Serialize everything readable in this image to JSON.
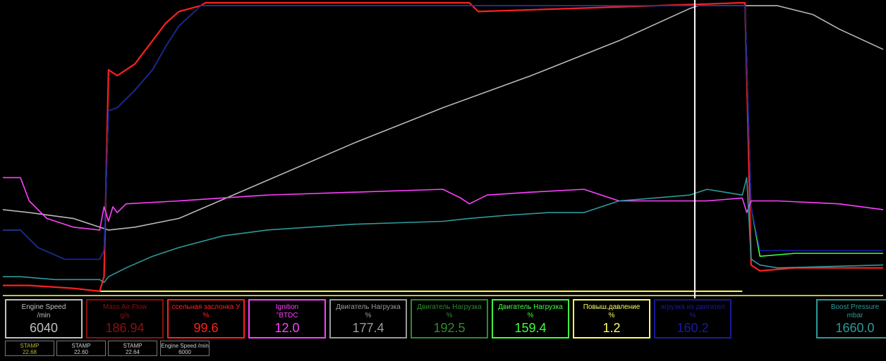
{
  "colors": {
    "engine_speed": "#b8b8b8",
    "maf": "#ff1a1a",
    "throttle": "#ff2020",
    "ignition": "#ff40ff",
    "load1": "#9a9a9a",
    "load2": "#2e8b2e",
    "load3": "#40ff40",
    "boost_req": "#ffff60",
    "load_ecu": "#1a1aa0",
    "boost": "#2e9a9a"
  },
  "gauges": [
    {
      "label": "Engine Speed",
      "unit": "/min",
      "value": "6040",
      "color": "#bfbfbf",
      "value_color": "#bfbfbf"
    },
    {
      "label": "Mass Air Flow",
      "unit": "g/s",
      "value": "186.94",
      "color": "#8b1010",
      "value_color": "#8b1010"
    },
    {
      "label": "ссельная заслонка У",
      "unit": "%",
      "value": "99.6",
      "color": "#ff2020",
      "value_color": "#ff2020"
    },
    {
      "label": "Ignition",
      "unit": "°BTDC",
      "value": "12.0",
      "color": "#ff40ff",
      "value_color": "#ff40ff"
    },
    {
      "label": "Двигатель Нагрузка",
      "unit": "%",
      "value": "177.4",
      "color": "#9a9a9a",
      "value_color": "#9a9a9a"
    },
    {
      "label": "Двигатель Нагрузка",
      "unit": "%",
      "value": "192.5",
      "color": "#2e8b2e",
      "value_color": "#2e8b2e"
    },
    {
      "label": "Двигатель Нагрузка",
      "unit": "%",
      "value": "159.4",
      "color": "#40ff40",
      "value_color": "#40ff40"
    },
    {
      "label": "Повыш.давление",
      "unit": "%",
      "value": "1.2",
      "color": "#ffff60",
      "value_color": "#ffff60"
    },
    {
      "label": "агрузка из двигател",
      "unit": "%",
      "value": "160.2",
      "color": "#1a1aa0",
      "value_color": "#1a1aa0"
    },
    {
      "label": "Boost Pressure",
      "unit": "mbar",
      "value": "1660.0",
      "color": "#2e9a9a",
      "value_color": "#2e9a9a"
    }
  ],
  "stamps": [
    {
      "label": "STAMP",
      "value": "22.68",
      "color": "#b8b830"
    },
    {
      "label": "STAMP",
      "value": "22.60",
      "color": "#cccccc"
    },
    {
      "label": "STAMP",
      "value": "22.64",
      "color": "#cccccc"
    },
    {
      "label": "Engine Speed /min",
      "value": "6000",
      "color": "#cccccc"
    }
  ],
  "chart_data": {
    "type": "line",
    "x_range": [
      0,
      100
    ],
    "y_range": [
      0,
      100
    ],
    "cursor_x": 78.6,
    "series": [
      {
        "key": "engine_speed",
        "x": [
          0,
          3,
          8,
          11,
          12,
          15,
          20,
          30,
          40,
          50,
          60,
          70,
          78,
          79,
          84,
          85,
          88,
          92,
          95,
          100
        ],
        "y": [
          29,
          28,
          26,
          23,
          22,
          23,
          26,
          39,
          52,
          64,
          75,
          87,
          98,
          99,
          99,
          99,
          99,
          96,
          91,
          84
        ]
      },
      {
        "key": "throttle",
        "x": [
          0,
          3,
          8,
          11,
          11.5,
          12,
          13,
          15,
          17,
          18.5,
          20,
          22.5,
          23,
          50,
          53,
          54,
          84,
          84.3,
          84.7,
          85,
          86,
          90,
          100
        ],
        "y": [
          3,
          3,
          2,
          1,
          6,
          77,
          75,
          79,
          87,
          93,
          97,
          99,
          100,
          100,
          100,
          97,
          100,
          100,
          50,
          10,
          8,
          9,
          9
        ]
      },
      {
        "key": "load3",
        "x": [
          0,
          2,
          4,
          7,
          10,
          11,
          11.5,
          12,
          13,
          15,
          17,
          18.5,
          20,
          22.5,
          84,
          84.3,
          84.6,
          85,
          86,
          90,
          100
        ],
        "y": [
          22,
          22,
          16,
          12,
          12,
          12,
          15,
          63,
          64,
          70,
          77,
          85,
          92,
          99,
          99,
          99,
          70,
          30,
          13,
          14,
          14
        ]
      },
      {
        "key": "load_ecu",
        "x": [
          0,
          2,
          4,
          7,
          10,
          11,
          11.5,
          12,
          13,
          15,
          17,
          18.5,
          20,
          22.5,
          84,
          84.3,
          84.6,
          85,
          86,
          90,
          100
        ],
        "y": [
          22,
          22,
          16,
          12,
          12,
          12,
          15,
          63,
          64,
          70,
          77,
          85,
          92,
          99,
          99,
          99,
          70,
          30,
          15,
          15,
          15
        ]
      },
      {
        "key": "ignition",
        "x": [
          0,
          2,
          3,
          5,
          8,
          11,
          11.5,
          12,
          12.5,
          13,
          14,
          20,
          30,
          40,
          50,
          52,
          53,
          55,
          60,
          66,
          70,
          80,
          84,
          84.5,
          85,
          88,
          95,
          100
        ],
        "y": [
          40,
          40,
          32,
          26,
          23,
          22,
          30,
          25,
          30,
          28,
          31,
          32,
          34,
          35,
          36,
          33,
          31,
          34,
          35,
          36,
          32,
          32,
          33,
          28,
          32,
          32,
          31,
          29
        ]
      },
      {
        "key": "boost",
        "x": [
          0,
          2,
          6,
          10,
          11,
          11.5,
          12,
          14,
          17,
          20,
          25,
          30,
          40,
          50,
          53,
          57,
          62,
          66,
          70,
          74,
          78,
          80,
          82,
          84,
          84.5,
          85,
          86,
          88,
          100
        ],
        "y": [
          6,
          6,
          5,
          5,
          5,
          4,
          6,
          9,
          13,
          16,
          20,
          22,
          24,
          25,
          26,
          27,
          28,
          28,
          32,
          33,
          34,
          36,
          35,
          34,
          40,
          12,
          10,
          9,
          10
        ]
      }
    ],
    "baseline": {
      "key": "boost_req",
      "y": 1
    }
  }
}
